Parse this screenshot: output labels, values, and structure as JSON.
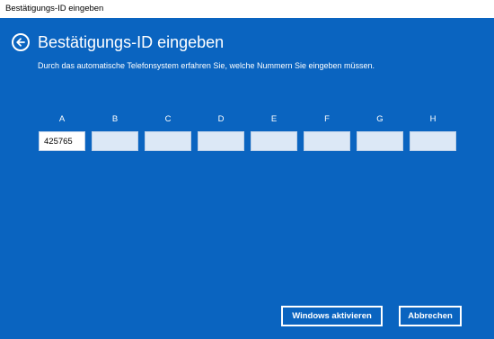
{
  "window": {
    "title": "Bestätigungs-ID eingeben"
  },
  "header": {
    "title": "Bestätigungs-ID eingeben",
    "subtitle": "Durch das automatische Telefonsystem erfahren Sie, welche Nummern Sie eingeben müssen."
  },
  "fields": [
    {
      "label": "A",
      "value": "425765"
    },
    {
      "label": "B",
      "value": ""
    },
    {
      "label": "C",
      "value": ""
    },
    {
      "label": "D",
      "value": ""
    },
    {
      "label": "E",
      "value": ""
    },
    {
      "label": "F",
      "value": ""
    },
    {
      "label": "G",
      "value": ""
    },
    {
      "label": "H",
      "value": ""
    }
  ],
  "buttons": {
    "activate_label": "Windows aktivieren",
    "cancel_label": "Abbrechen"
  },
  "colors": {
    "background": "#0a64c0",
    "field": "#dce8f6",
    "text": "#ffffff"
  },
  "icons": {
    "back": "back-arrow-icon"
  }
}
